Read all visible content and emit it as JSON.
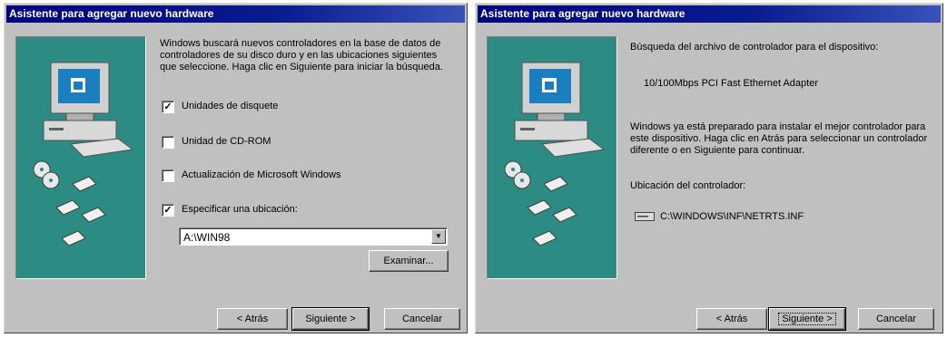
{
  "left": {
    "title": "Asistente para agregar nuevo hardware",
    "description": "Windows buscará nuevos controladores en la base de datos de controladores de su disco duro y en las ubicaciones siguientes que seleccione. Haga clic en Siguiente para iniciar la búsqueda.",
    "options": [
      {
        "label": "Unidades de disquete",
        "checked": true
      },
      {
        "label": "Unidad de CD-ROM",
        "checked": false
      },
      {
        "label": "Actualización de Microsoft Windows",
        "checked": false
      },
      {
        "label": "Especificar una ubicación:",
        "checked": true
      }
    ],
    "location_value": "A:\\WIN98",
    "browse_label": "Examinar...",
    "back_label": "< Atrás",
    "next_label": "Siguiente >",
    "cancel_label": "Cancelar"
  },
  "right": {
    "title": "Asistente para agregar nuevo hardware",
    "search_text": "Búsqueda del archivo de controlador para el dispositivo:",
    "device_name": "10/100Mbps PCI Fast Ethernet Adapter",
    "ready_text": "Windows ya está preparado para instalar el mejor controlador para este dispositivo. Haga clic en Atrás para seleccionar un controlador diferente o en Siguiente para continuar.",
    "location_label": "Ubicación del controlador:",
    "driver_path": "C:\\WINDOWS\\INF\\NETRTS.INF",
    "back_label": "< Atrás",
    "next_label": "Siguiente >",
    "cancel_label": "Cancelar"
  },
  "colors": {
    "titlebar": "#000080",
    "dialog_face": "#c0c0c0",
    "art_panel": "#2c8b82"
  },
  "icons": {
    "art": "computer-with-discs-illustration",
    "drive": "disk-drive-icon",
    "checkmark": "✓",
    "dropdown": "▼"
  }
}
